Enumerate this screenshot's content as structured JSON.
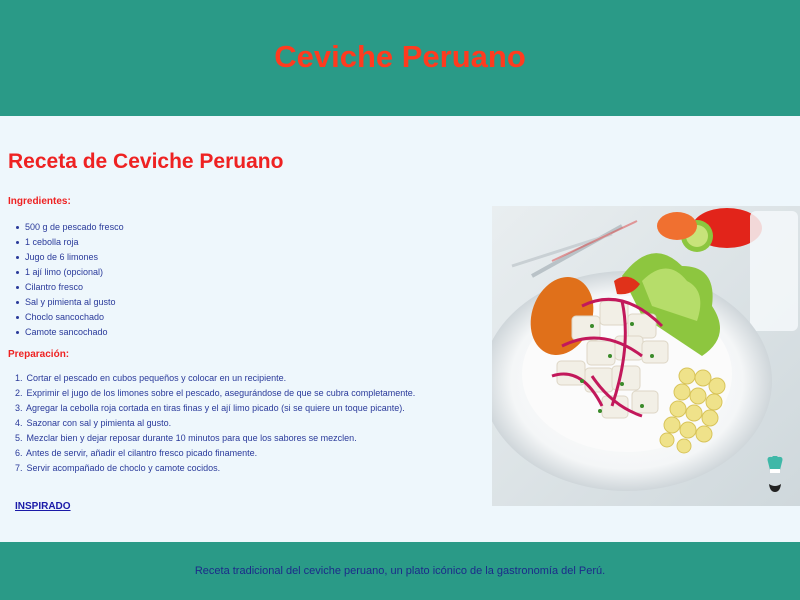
{
  "header": {
    "title": "Ceviche Peruano"
  },
  "recipe": {
    "title": "Receta de Ceviche Peruano",
    "ingredients_label": "Ingredientes:",
    "ingredients": [
      "500 g de pescado fresco",
      "1 cebolla roja",
      "Jugo de 6 limones",
      "1 ají limo (opcional)",
      "Cilantro fresco",
      "Sal y pimienta al gusto",
      "Choclo sancochado",
      "Camote sancochado"
    ],
    "steps_label": "Preparación:",
    "steps": [
      "Cortar el pescado en cubos pequeños y colocar en un recipiente.",
      "Exprimir el jugo de los limones sobre el pescado, asegurándose de que se cubra completamente.",
      "Agregar la cebolla roja cortada en tiras finas y el ají limo picado (si se quiere un toque picante).",
      "Sazonar con sal y pimienta al gusto.",
      "Mezclar bien y dejar reposar durante 10 minutos para que los sabores se mezclen.",
      "Antes de servir, añadir el cilantro fresco picado finamente.",
      "Servir acompañado de choclo y camote cocidos."
    ],
    "link_label": "INSPIRADO"
  },
  "photo": {
    "icon": "chef-hat-icon"
  },
  "footer": {
    "text": "Receta tradicional del ceviche peruano, un plato icónico de la gastronomía del Perú."
  },
  "colors": {
    "header_bg": "#2a9a87",
    "title": "#ff3b1f",
    "section": "#ee2222",
    "text": "#2a3a9a",
    "link": "#1a1aa8",
    "page_bg": "#eef7fc"
  }
}
